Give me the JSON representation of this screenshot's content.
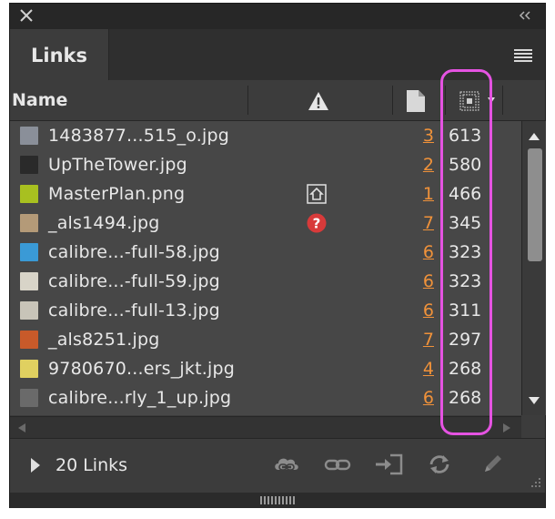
{
  "panel": {
    "tab_label": "Links",
    "column_name_label": "Name",
    "footer_count": "20 Links"
  },
  "links": [
    {
      "name": "1483877...515_o.jpg",
      "status": "",
      "page": "3",
      "ppi": "613",
      "thumb_color": "#8a8f99"
    },
    {
      "name": "UpTheTower.jpg",
      "status": "",
      "page": "2",
      "ppi": "580",
      "thumb_color": "#2a2a2a"
    },
    {
      "name": "MasterPlan.png",
      "status": "modified",
      "page": "1",
      "ppi": "466",
      "thumb_color": "#a8c020"
    },
    {
      "name": "_als1494.jpg",
      "status": "missing",
      "page": "7",
      "ppi": "345",
      "thumb_color": "#b49a78"
    },
    {
      "name": "calibre...-full-58.jpg",
      "status": "",
      "page": "6",
      "ppi": "323",
      "thumb_color": "#3a9ad6"
    },
    {
      "name": "calibre...-full-59.jpg",
      "status": "",
      "page": "6",
      "ppi": "323",
      "thumb_color": "#d8d4c8"
    },
    {
      "name": "calibre...-full-13.jpg",
      "status": "",
      "page": "6",
      "ppi": "311",
      "thumb_color": "#c8c4b8"
    },
    {
      "name": "_als8251.jpg",
      "status": "",
      "page": "7",
      "ppi": "297",
      "thumb_color": "#c85a2a"
    },
    {
      "name": "9780670...ers_jkt.jpg",
      "status": "",
      "page": "4",
      "ppi": "268",
      "thumb_color": "#e0d060"
    },
    {
      "name": "calibre...rly_1_up.jpg",
      "status": "",
      "page": "6",
      "ppi": "268",
      "thumb_color": "#6a6a6a"
    }
  ],
  "colors": {
    "panel_bg": "#3c3c3c",
    "list_bg": "#474747",
    "page_link": "#f0923a",
    "missing_badge": "#d83a3a",
    "highlight": "#e553e2"
  }
}
